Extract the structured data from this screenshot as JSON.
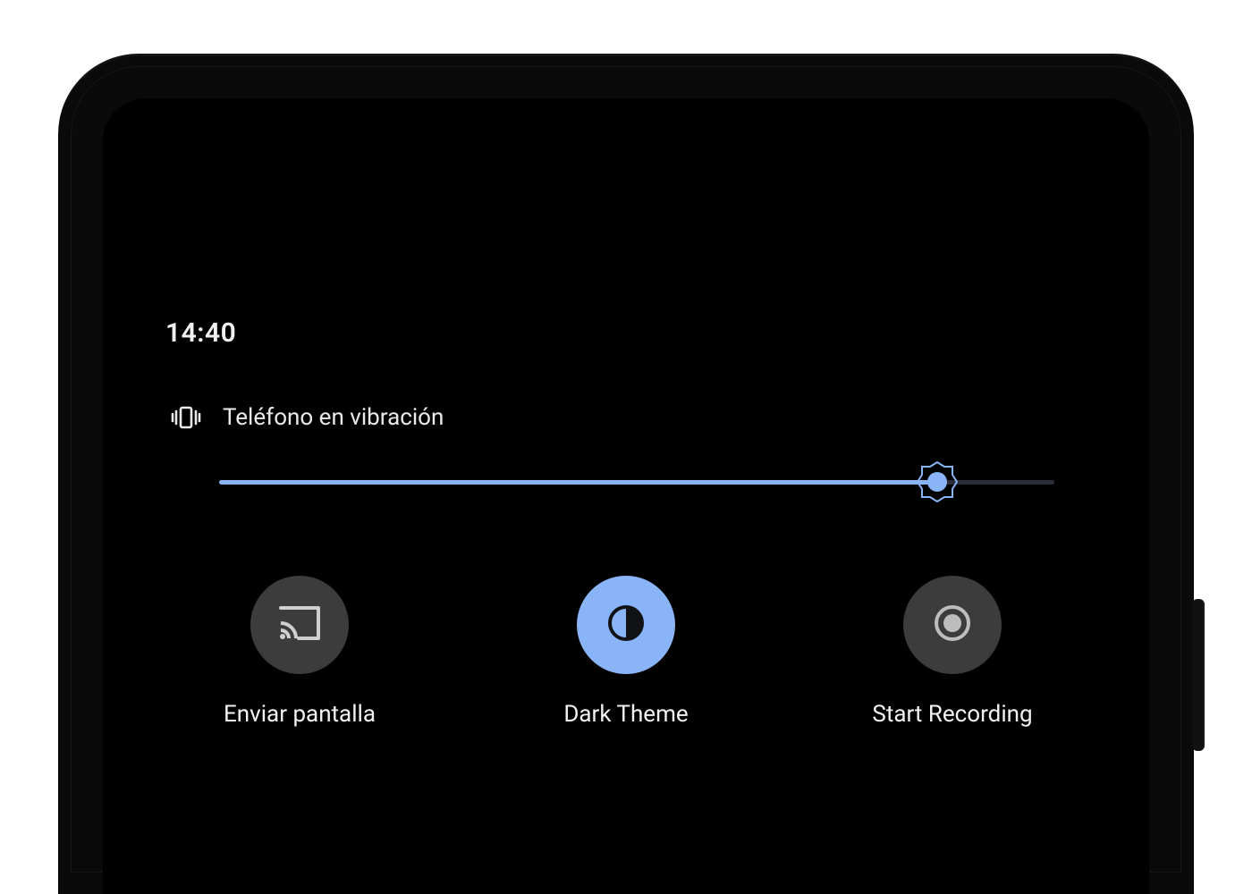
{
  "statusBar": {
    "time": "14:40"
  },
  "quickSettings": {
    "headerLabel": "Teléfono en vibración",
    "brightnessPercent": 86,
    "tiles": [
      {
        "label": "Enviar pantalla",
        "state": "off",
        "icon": "cast"
      },
      {
        "label": "Dark Theme",
        "state": "on",
        "icon": "dark-theme"
      },
      {
        "label": "Start Recording",
        "state": "off",
        "icon": "record"
      }
    ]
  },
  "colors": {
    "accent": "#8ab4f8",
    "tileOff": "#3c3c3c"
  }
}
